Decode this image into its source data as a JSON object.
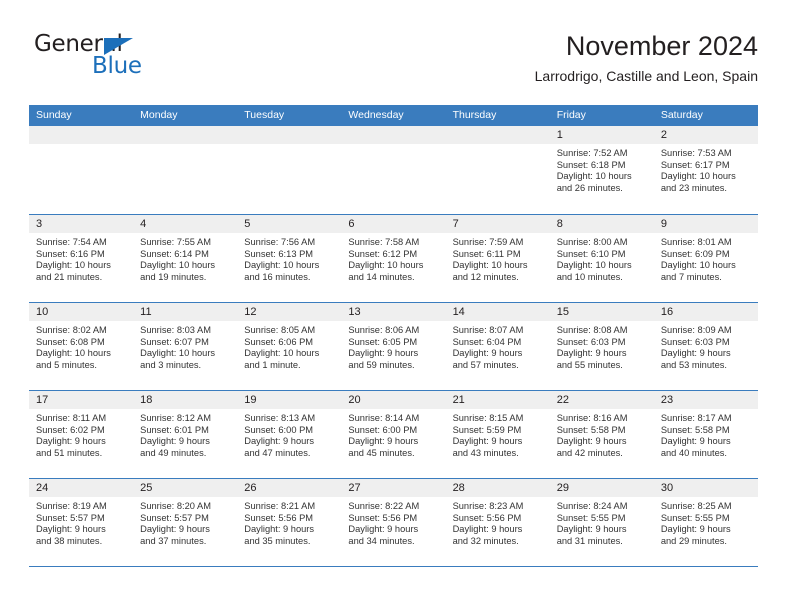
{
  "brand": {
    "name_part1": "General",
    "name_part2": "Blue",
    "triangle_color": "#1c6fba"
  },
  "header": {
    "title": "November 2024",
    "subtitle": "Larrodrigo, Castille and Leon, Spain"
  },
  "theme": {
    "header_blue": "#3a7cbe",
    "day_band_gray": "#efefef",
    "text_color": "#231f20"
  },
  "labels": {
    "sunrise_prefix": "Sunrise:",
    "sunset_prefix": "Sunset:",
    "daylight_prefix": "Daylight:"
  },
  "weekdays": [
    "Sunday",
    "Monday",
    "Tuesday",
    "Wednesday",
    "Thursday",
    "Friday",
    "Saturday"
  ],
  "weeks": [
    [
      {
        "day": "",
        "empty": true
      },
      {
        "day": "",
        "empty": true
      },
      {
        "day": "",
        "empty": true
      },
      {
        "day": "",
        "empty": true
      },
      {
        "day": "",
        "empty": true
      },
      {
        "day": "1",
        "sunrise": "Sunrise: 7:52 AM",
        "sunset": "Sunset: 6:18 PM",
        "daylight_l1": "Daylight: 10 hours",
        "daylight_l2": "and 26 minutes."
      },
      {
        "day": "2",
        "sunrise": "Sunrise: 7:53 AM",
        "sunset": "Sunset: 6:17 PM",
        "daylight_l1": "Daylight: 10 hours",
        "daylight_l2": "and 23 minutes."
      }
    ],
    [
      {
        "day": "3",
        "sunrise": "Sunrise: 7:54 AM",
        "sunset": "Sunset: 6:16 PM",
        "daylight_l1": "Daylight: 10 hours",
        "daylight_l2": "and 21 minutes."
      },
      {
        "day": "4",
        "sunrise": "Sunrise: 7:55 AM",
        "sunset": "Sunset: 6:14 PM",
        "daylight_l1": "Daylight: 10 hours",
        "daylight_l2": "and 19 minutes."
      },
      {
        "day": "5",
        "sunrise": "Sunrise: 7:56 AM",
        "sunset": "Sunset: 6:13 PM",
        "daylight_l1": "Daylight: 10 hours",
        "daylight_l2": "and 16 minutes."
      },
      {
        "day": "6",
        "sunrise": "Sunrise: 7:58 AM",
        "sunset": "Sunset: 6:12 PM",
        "daylight_l1": "Daylight: 10 hours",
        "daylight_l2": "and 14 minutes."
      },
      {
        "day": "7",
        "sunrise": "Sunrise: 7:59 AM",
        "sunset": "Sunset: 6:11 PM",
        "daylight_l1": "Daylight: 10 hours",
        "daylight_l2": "and 12 minutes."
      },
      {
        "day": "8",
        "sunrise": "Sunrise: 8:00 AM",
        "sunset": "Sunset: 6:10 PM",
        "daylight_l1": "Daylight: 10 hours",
        "daylight_l2": "and 10 minutes."
      },
      {
        "day": "9",
        "sunrise": "Sunrise: 8:01 AM",
        "sunset": "Sunset: 6:09 PM",
        "daylight_l1": "Daylight: 10 hours",
        "daylight_l2": "and 7 minutes."
      }
    ],
    [
      {
        "day": "10",
        "sunrise": "Sunrise: 8:02 AM",
        "sunset": "Sunset: 6:08 PM",
        "daylight_l1": "Daylight: 10 hours",
        "daylight_l2": "and 5 minutes."
      },
      {
        "day": "11",
        "sunrise": "Sunrise: 8:03 AM",
        "sunset": "Sunset: 6:07 PM",
        "daylight_l1": "Daylight: 10 hours",
        "daylight_l2": "and 3 minutes."
      },
      {
        "day": "12",
        "sunrise": "Sunrise: 8:05 AM",
        "sunset": "Sunset: 6:06 PM",
        "daylight_l1": "Daylight: 10 hours",
        "daylight_l2": "and 1 minute."
      },
      {
        "day": "13",
        "sunrise": "Sunrise: 8:06 AM",
        "sunset": "Sunset: 6:05 PM",
        "daylight_l1": "Daylight: 9 hours",
        "daylight_l2": "and 59 minutes."
      },
      {
        "day": "14",
        "sunrise": "Sunrise: 8:07 AM",
        "sunset": "Sunset: 6:04 PM",
        "daylight_l1": "Daylight: 9 hours",
        "daylight_l2": "and 57 minutes."
      },
      {
        "day": "15",
        "sunrise": "Sunrise: 8:08 AM",
        "sunset": "Sunset: 6:03 PM",
        "daylight_l1": "Daylight: 9 hours",
        "daylight_l2": "and 55 minutes."
      },
      {
        "day": "16",
        "sunrise": "Sunrise: 8:09 AM",
        "sunset": "Sunset: 6:03 PM",
        "daylight_l1": "Daylight: 9 hours",
        "daylight_l2": "and 53 minutes."
      }
    ],
    [
      {
        "day": "17",
        "sunrise": "Sunrise: 8:11 AM",
        "sunset": "Sunset: 6:02 PM",
        "daylight_l1": "Daylight: 9 hours",
        "daylight_l2": "and 51 minutes."
      },
      {
        "day": "18",
        "sunrise": "Sunrise: 8:12 AM",
        "sunset": "Sunset: 6:01 PM",
        "daylight_l1": "Daylight: 9 hours",
        "daylight_l2": "and 49 minutes."
      },
      {
        "day": "19",
        "sunrise": "Sunrise: 8:13 AM",
        "sunset": "Sunset: 6:00 PM",
        "daylight_l1": "Daylight: 9 hours",
        "daylight_l2": "and 47 minutes."
      },
      {
        "day": "20",
        "sunrise": "Sunrise: 8:14 AM",
        "sunset": "Sunset: 6:00 PM",
        "daylight_l1": "Daylight: 9 hours",
        "daylight_l2": "and 45 minutes."
      },
      {
        "day": "21",
        "sunrise": "Sunrise: 8:15 AM",
        "sunset": "Sunset: 5:59 PM",
        "daylight_l1": "Daylight: 9 hours",
        "daylight_l2": "and 43 minutes."
      },
      {
        "day": "22",
        "sunrise": "Sunrise: 8:16 AM",
        "sunset": "Sunset: 5:58 PM",
        "daylight_l1": "Daylight: 9 hours",
        "daylight_l2": "and 42 minutes."
      },
      {
        "day": "23",
        "sunrise": "Sunrise: 8:17 AM",
        "sunset": "Sunset: 5:58 PM",
        "daylight_l1": "Daylight: 9 hours",
        "daylight_l2": "and 40 minutes."
      }
    ],
    [
      {
        "day": "24",
        "sunrise": "Sunrise: 8:19 AM",
        "sunset": "Sunset: 5:57 PM",
        "daylight_l1": "Daylight: 9 hours",
        "daylight_l2": "and 38 minutes."
      },
      {
        "day": "25",
        "sunrise": "Sunrise: 8:20 AM",
        "sunset": "Sunset: 5:57 PM",
        "daylight_l1": "Daylight: 9 hours",
        "daylight_l2": "and 37 minutes."
      },
      {
        "day": "26",
        "sunrise": "Sunrise: 8:21 AM",
        "sunset": "Sunset: 5:56 PM",
        "daylight_l1": "Daylight: 9 hours",
        "daylight_l2": "and 35 minutes."
      },
      {
        "day": "27",
        "sunrise": "Sunrise: 8:22 AM",
        "sunset": "Sunset: 5:56 PM",
        "daylight_l1": "Daylight: 9 hours",
        "daylight_l2": "and 34 minutes."
      },
      {
        "day": "28",
        "sunrise": "Sunrise: 8:23 AM",
        "sunset": "Sunset: 5:56 PM",
        "daylight_l1": "Daylight: 9 hours",
        "daylight_l2": "and 32 minutes."
      },
      {
        "day": "29",
        "sunrise": "Sunrise: 8:24 AM",
        "sunset": "Sunset: 5:55 PM",
        "daylight_l1": "Daylight: 9 hours",
        "daylight_l2": "and 31 minutes."
      },
      {
        "day": "30",
        "sunrise": "Sunrise: 8:25 AM",
        "sunset": "Sunset: 5:55 PM",
        "daylight_l1": "Daylight: 9 hours",
        "daylight_l2": "and 29 minutes."
      }
    ]
  ]
}
